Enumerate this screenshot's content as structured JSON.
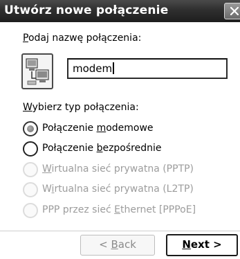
{
  "window": {
    "title": "Utwórz nowe połączenie"
  },
  "name_section": {
    "label_accel": "P",
    "label_rest": "odaj nazwę połączenia:",
    "input_value": "modem",
    "icon": "network-connection-icon"
  },
  "type_section": {
    "label_accel": "W",
    "label_rest": "ybierz typ połączenia:",
    "options": [
      {
        "pre": "Połączenie ",
        "accel": "m",
        "post": "odemowe",
        "checked": true,
        "enabled": true
      },
      {
        "pre": "Połączenie ",
        "accel": "b",
        "post": "ezpośrednie",
        "checked": false,
        "enabled": true
      },
      {
        "pre": "",
        "accel": "W",
        "post": "irtualna sieć prywatna (PPTP)",
        "checked": false,
        "enabled": false
      },
      {
        "pre": "W",
        "accel": "i",
        "post": "rtualna sieć prywatna (L2TP)",
        "checked": false,
        "enabled": false
      },
      {
        "pre": "PPP przez sieć ",
        "accel": "E",
        "post": "thernet [PPPoE]",
        "checked": false,
        "enabled": false
      }
    ]
  },
  "buttons": {
    "back_pre": "< ",
    "back_accel": "B",
    "back_post": "ack",
    "next_accel": "N",
    "next_post": "ext >"
  },
  "colors": {
    "titlebar": "#2f2f2f",
    "disabled_text": "#9c9c9c"
  }
}
